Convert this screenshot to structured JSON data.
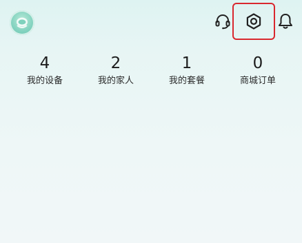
{
  "header": {
    "avatar_icon": "user-avatar-icon",
    "support_icon": "headset-icon",
    "settings_icon": "hexagon-gear-icon",
    "notification_icon": "bell-icon",
    "highlight_color": "#d9272e"
  },
  "stats": [
    {
      "value": "4",
      "label": "我的设备"
    },
    {
      "value": "2",
      "label": "我的家人"
    },
    {
      "value": "1",
      "label": "我的套餐"
    },
    {
      "value": "0",
      "label": "商城订单"
    }
  ]
}
